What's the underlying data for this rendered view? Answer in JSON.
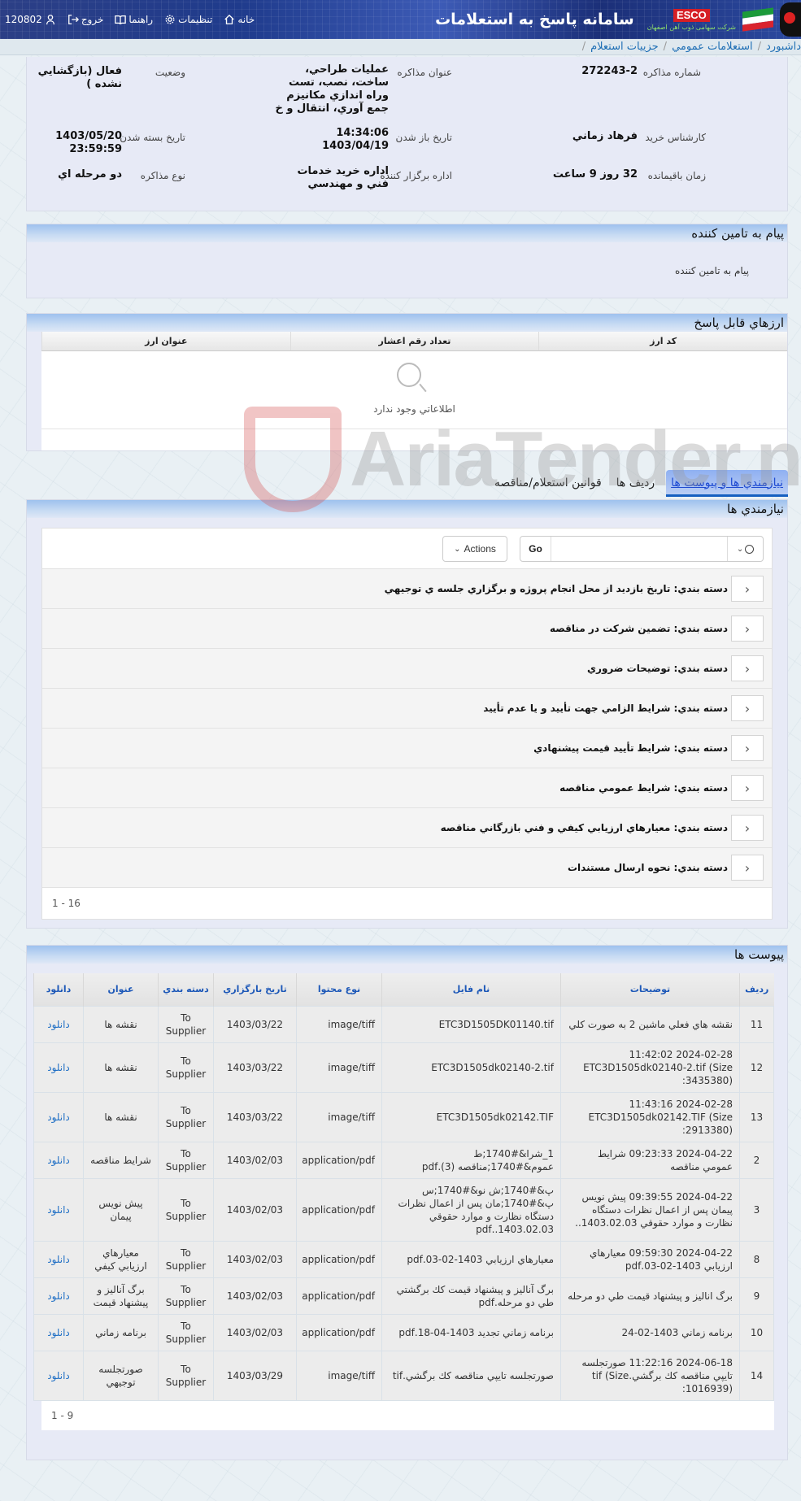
{
  "header": {
    "app_title": "سامانه پاسخ به استعلامات",
    "logo_text": "ESCO",
    "logo_subtitle": "شرکت سهامی ذوب آهن اصفهان",
    "nav": [
      {
        "label": "خانه",
        "icon": "home-icon"
      },
      {
        "label": "تنظیمات",
        "icon": "gear-icon"
      },
      {
        "label": "راهنما",
        "icon": "book-icon"
      },
      {
        "label": "خروج",
        "icon": "logout-icon"
      },
      {
        "label": "120802",
        "icon": "user-icon"
      }
    ]
  },
  "breadcrumb": [
    "داشبورد",
    "استعلامات عمومي",
    "جزييات استعلام"
  ],
  "info": {
    "number_label": "شماره مذاكره",
    "number": "272243-2",
    "title_label": "عنوان مذاكره",
    "title": "عمليات طراحي، ساخت، نصب، تست وراه اندازي مكانيزم جمع آوري، انتقال و خ",
    "status_label": "وضعيت",
    "status": "فعال (بازگشايي نشده )",
    "expert_label": "كارشناس خريد",
    "expert": "فرهاد زماني",
    "open_date_label": "تاريخ باز شدن",
    "open_time": "14:34:06",
    "open_date": "1403/04/19",
    "close_date_label": "تاريخ بسته شدن",
    "close_date": "1403/05/20 23:59:59",
    "remaining_label": "زمان باقيمانده",
    "remaining": "32 روز 9 ساعت",
    "dept_label": "اداره برگزار كننده",
    "dept": "اداره خريد خدمات فني و مهندسي",
    "type_label": "نوع مذاكره",
    "type": "دو مرحله اي"
  },
  "supplier_message": {
    "title": "پيام به تامين كننده",
    "text": "پيام به تامين كننده"
  },
  "currencies": {
    "title": "ارزهاي قابل پاسخ",
    "columns": [
      "كد ارز",
      "تعداد رقم اعشار",
      "عنوان ارز"
    ],
    "empty_text": "اطلاعاتي وجود ندارد"
  },
  "watermark": "AriaTender.neT",
  "tabs": [
    {
      "label": "نيازمندي ها و پيوست ها",
      "active": true
    },
    {
      "label": "رديف ها",
      "active": false
    },
    {
      "label": "قوانين استعلام/مناقصه",
      "active": false
    }
  ],
  "requirements": {
    "title": "نيازمندي ها",
    "search_placeholder": "",
    "go_label": "Go",
    "actions_label": "Actions",
    "rows": [
      "دسته بندي: تاريخ بازديد از محل انجام پروژه و برگزاري جلسه ي توجيهي",
      "دسته بندي: تضمين شركت در مناقصه",
      "دسته بندي: توضيحات ضروري",
      "دسته بندي: شرايط الزامي جهت تأييد و يا عدم تأييد",
      "دسته بندي: شرايط تأييد قيمت پيشنهادي",
      "دسته بندي: شرايط عمومي مناقصه",
      "دسته بندي: معيارهاي ارزيابي كيفي و فني بازرگاني مناقصه",
      "دسته بندي: نحوه ارسال مستندات"
    ],
    "pagination": "1 - 16"
  },
  "attachments": {
    "title": "پيوست ها",
    "columns": [
      "رديف",
      "توضيحات",
      "نام فايل",
      "نوع محتوا",
      "تاريخ بارگزاري",
      "دسته بندي",
      "عنوان",
      "دانلود"
    ],
    "rows": [
      {
        "row": "11",
        "desc": "نقشه هاي فعلي ماشين 2 به صورت كلي",
        "file": "ETC3D1505DK01140.tif",
        "type": "image/tiff",
        "date": "1403/03/22",
        "category": "To Supplier",
        "title": "نقشه ها",
        "download": "دانلود"
      },
      {
        "row": "12",
        "desc": "2024-02-28 11:42:02 ETC3D1505dk02140-2.tif (Size :3435380)",
        "file": "ETC3D1505dk02140-2.tif",
        "type": "image/tiff",
        "date": "1403/03/22",
        "category": "To Supplier",
        "title": "نقشه ها",
        "download": "دانلود"
      },
      {
        "row": "13",
        "desc": "2024-02-28 11:43:16 ETC3D1505dk02142.TIF (Size :2913380)",
        "file": "ETC3D1505dk02142.TIF",
        "type": "image/tiff",
        "date": "1403/03/22",
        "category": "To Supplier",
        "title": "نقشه ها",
        "download": "دانلود"
      },
      {
        "row": "2",
        "desc": "2024-04-22 09:23:33 شرايط عمومي مناقصه",
        "file": "1_شرا&#1740;ط عموم&#1740;مناقصه (3).pdf",
        "type": "application/pdf",
        "date": "1403/02/03",
        "category": "To Supplier",
        "title": "شرايط مناقصه",
        "download": "دانلود"
      },
      {
        "row": "3",
        "desc": "2024-04-22 09:39:55 پيش نويس پيمان پس از اعمال نظرات دستگاه نظارت و موارد حقوقي 1403.02.03..",
        "file": "پ&#1740;ش نو&#1740;س پ&#1740;مان پس از اعمال نظرات دستگاه نظارت و موارد حقوقي 1403.02.03..pdf",
        "type": "application/pdf",
        "date": "1403/02/03",
        "category": "To Supplier",
        "title": "پيش نويس پيمان",
        "download": "دانلود"
      },
      {
        "row": "8",
        "desc": "2024-04-22 09:59:30 معيارهاي ارزيابي 1403-02-03.pdf",
        "file": "معيارهاي ارزيابي 1403-02-03.pdf",
        "type": "application/pdf",
        "date": "1403/02/03",
        "category": "To Supplier",
        "title": "معيارهاي ارزيابي كيفي",
        "download": "دانلود"
      },
      {
        "row": "9",
        "desc": "برگ اناليز و پيشنهاد قيمت طي دو مرحله",
        "file": "برگ آناليز و پيشنهاد قيمت كك برگشتي طي دو مرحله.pdf",
        "type": "application/pdf",
        "date": "1403/02/03",
        "category": "To Supplier",
        "title": "برگ آناليز و پيشنهاد قيمت",
        "download": "دانلود"
      },
      {
        "row": "10",
        "desc": "برنامه زماني 1403-02-24",
        "file": "برنامه زماني تجديد 1403-04-18.pdf",
        "type": "application/pdf",
        "date": "1403/02/03",
        "category": "To Supplier",
        "title": "برنامه زماني",
        "download": "دانلود"
      },
      {
        "row": "14",
        "desc": "2024-06-18 11:22:16 صورتجلسه تايپي مناقصه كك برگشي.tif (Size :1016939)",
        "file": "صورتجلسه تايپي مناقصه كك برگشي.tif",
        "type": "image/tiff",
        "date": "1403/03/29",
        "category": "To Supplier",
        "title": "صورتجلسه توجيهي",
        "download": "دانلود"
      }
    ],
    "pagination": "1 - 9"
  }
}
